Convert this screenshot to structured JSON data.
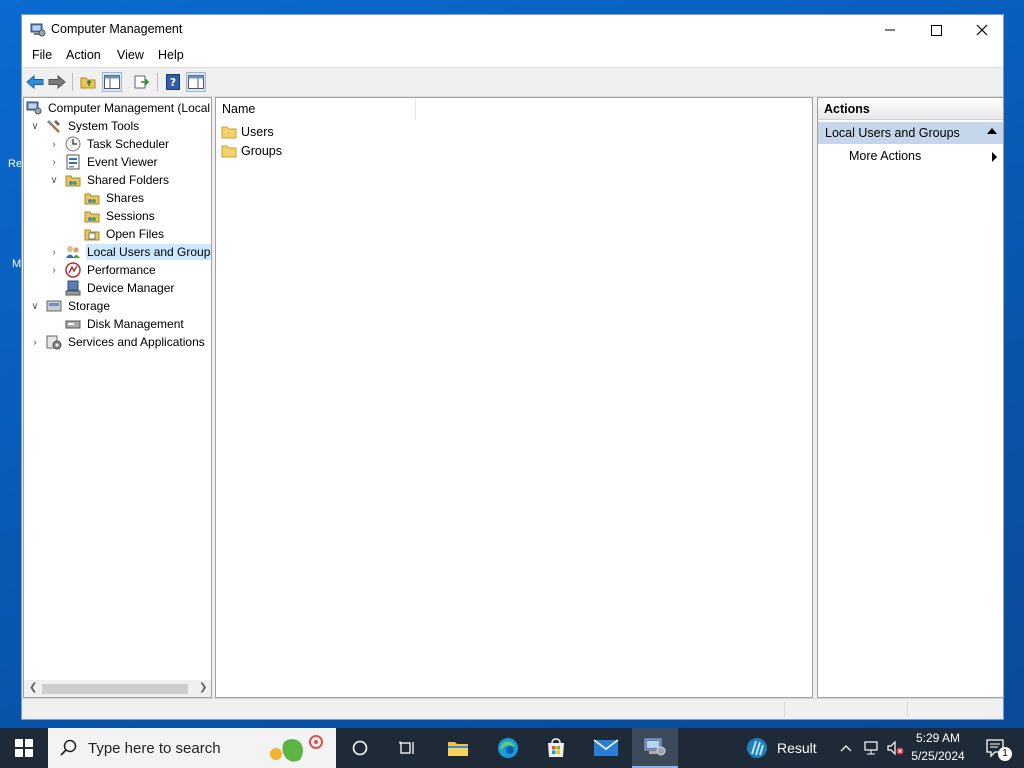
{
  "window": {
    "title": "Computer Management"
  },
  "menu": [
    "File",
    "Action",
    "View",
    "Help"
  ],
  "tree": {
    "items": [
      {
        "label": "Computer Management (Local"
      },
      {
        "label": "System Tools"
      },
      {
        "label": "Task Scheduler"
      },
      {
        "label": "Event Viewer"
      },
      {
        "label": "Shared Folders"
      },
      {
        "label": "Shares"
      },
      {
        "label": "Sessions"
      },
      {
        "label": "Open Files"
      },
      {
        "label": "Local Users and Groups"
      },
      {
        "label": "Performance"
      },
      {
        "label": "Device Manager"
      },
      {
        "label": "Storage"
      },
      {
        "label": "Disk Management"
      },
      {
        "label": "Services and Applications"
      }
    ],
    "selected": "Local Users and Groups"
  },
  "list": {
    "column_name": "Name",
    "items": [
      {
        "label": "Users",
        "icon": "folder-icon"
      },
      {
        "label": "Groups",
        "icon": "folder-icon"
      }
    ]
  },
  "actions": {
    "header": "Actions",
    "section": "Local Users and Groups",
    "more_actions": "More Actions"
  },
  "taskbar": {
    "search_placeholder": "Type here to search",
    "pinned_app_label": "Result",
    "time": "5:29 AM",
    "date": "5/25/2024",
    "notification_count": "1"
  },
  "desktop": {
    "fragment_1": "Re",
    "fragment_2": "M"
  },
  "colors": {
    "selection": "#cce8ff",
    "actions_section": "#c6d6ea",
    "taskbar": "#1e2a38",
    "desktop": "#0a6bd0"
  }
}
